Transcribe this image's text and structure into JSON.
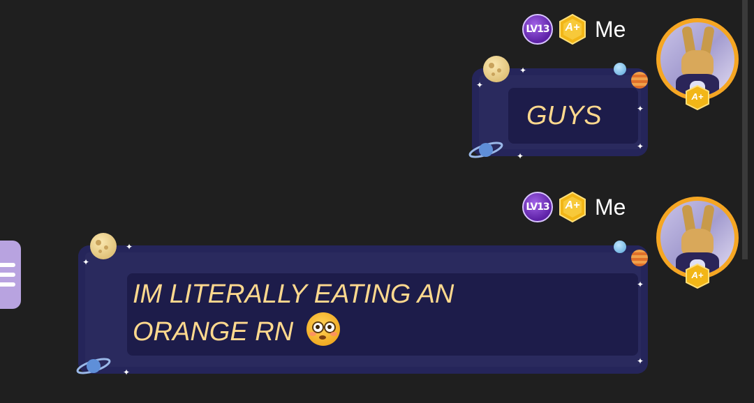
{
  "messages": [
    {
      "level": "LV13",
      "rank_badge": "A+",
      "username": "Me",
      "text": "GUYS",
      "avatar_badge": "A+"
    },
    {
      "level": "LV13",
      "rank_badge": "A+",
      "username": "Me",
      "text_line1": "IM LITERALLY EATING AN",
      "text_line2": "ORANGE RN",
      "emoji": "flushed-face",
      "avatar_badge": "A+"
    }
  ],
  "colors": {
    "background": "#1f1f1f",
    "bubble": "#2a2a5e",
    "bubble_text": "#ffd98e",
    "avatar_ring": "#f5a623",
    "level_badge": "#7b3fcc",
    "side_handle": "#b8a3e0"
  },
  "icons": {
    "side_handle": "menu-lines-icon",
    "decor": [
      "moon-icon",
      "planet-icon",
      "saturn-icon",
      "star-icon"
    ]
  }
}
